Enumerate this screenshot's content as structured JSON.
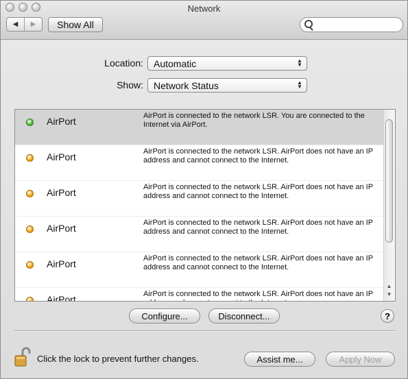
{
  "window": {
    "title": "Network"
  },
  "toolbar": {
    "back_glyph": "◀",
    "forward_glyph": "▶",
    "show_all_label": "Show All",
    "search_value": ""
  },
  "location": {
    "label": "Location:",
    "value": "Automatic"
  },
  "show": {
    "label": "Show:",
    "value": "Network Status"
  },
  "status_list": [
    {
      "name": "AirPort",
      "status_color": "#43b62a",
      "selected": true,
      "description": "AirPort is connected to the network LSR. You are connected to the Internet via AirPort."
    },
    {
      "name": "AirPort",
      "status_color": "#f2a000",
      "selected": false,
      "description": "AirPort is connected to the network LSR. AirPort does not have an IP address and cannot connect to the Internet."
    },
    {
      "name": "AirPort",
      "status_color": "#f2a000",
      "selected": false,
      "description": "AirPort is connected to the network LSR. AirPort does not have an IP address and cannot connect to the Internet."
    },
    {
      "name": "AirPort",
      "status_color": "#f2a000",
      "selected": false,
      "description": "AirPort is connected to the network LSR. AirPort does not have an IP address and cannot connect to the Internet."
    },
    {
      "name": "AirPort",
      "status_color": "#f2a000",
      "selected": false,
      "description": "AirPort is connected to the network LSR. AirPort does not have an IP address and cannot connect to the Internet."
    },
    {
      "name": "AirPort",
      "status_color": "#f2a000",
      "selected": false,
      "description": "AirPort is connected to the network LSR. AirPort does not have an IP address and cannot connect to the Internet."
    }
  ],
  "buttons": {
    "configure": "Configure...",
    "disconnect": "Disconnect...",
    "help": "?",
    "assist": "Assist me...",
    "apply": "Apply Now"
  },
  "lock": {
    "text": "Click the lock to prevent further changes.",
    "icon": "padlock-open-icon"
  }
}
